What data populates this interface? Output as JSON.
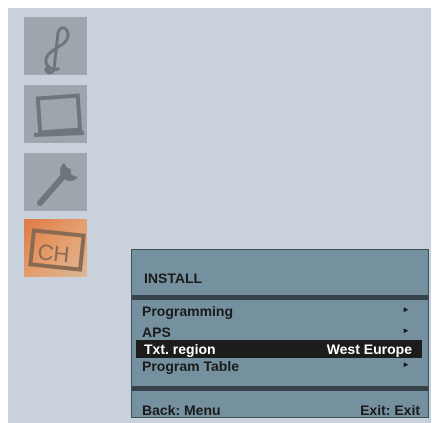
{
  "icons": {
    "music": "treble-clef-icon",
    "picture": "tv-screen-icon",
    "setup": "wrench-icon",
    "install": "channel-icon",
    "install_text": "CH"
  },
  "colors": {
    "screen_bg": "#c9d1dc",
    "menu_bg": "#75909e",
    "selected_bg": "#1c1c1c",
    "active_tile": "#e07a45"
  },
  "menu": {
    "title": "INSTALL",
    "items": [
      {
        "label": "Programming",
        "arrow": "►"
      },
      {
        "label": "APS",
        "arrow": "►"
      },
      {
        "label": "Txt. region",
        "value": "West Europe"
      },
      {
        "label": "Program Table",
        "arrow": "►"
      }
    ],
    "footer": {
      "back": "Back: Menu",
      "exit": "Exit: Exit"
    }
  }
}
